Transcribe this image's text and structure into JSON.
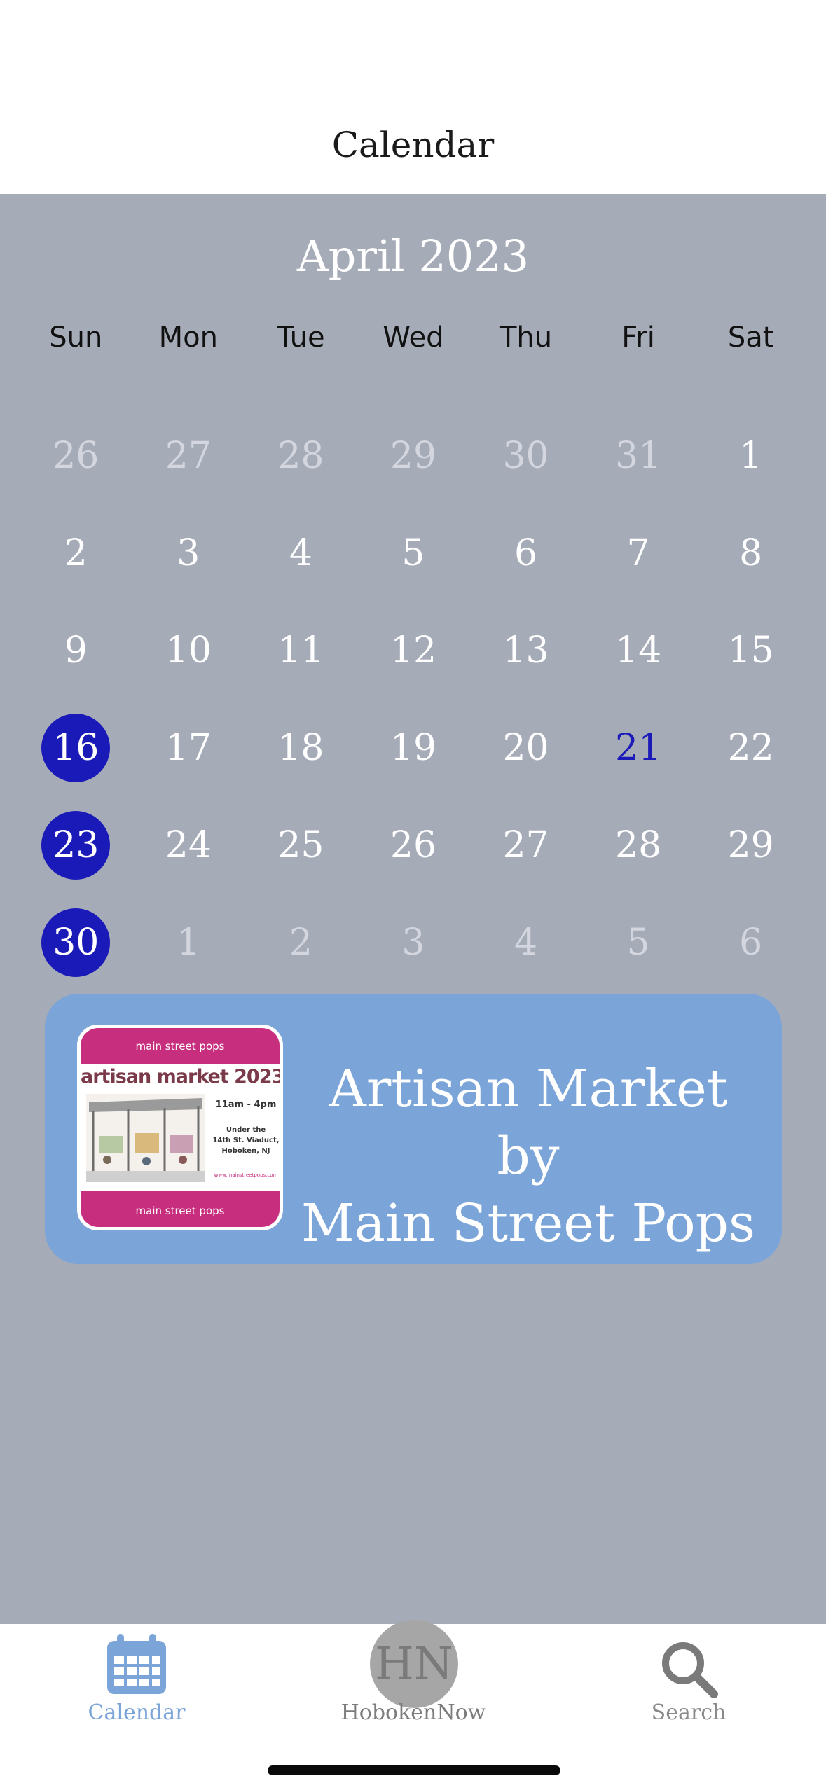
{
  "header": {
    "title": "Calendar"
  },
  "calendar": {
    "month_title": "April 2023",
    "weekdays": [
      "Sun",
      "Mon",
      "Tue",
      "Wed",
      "Thu",
      "Fri",
      "Sat"
    ],
    "days": [
      {
        "n": "26",
        "state": "muted"
      },
      {
        "n": "27",
        "state": "muted"
      },
      {
        "n": "28",
        "state": "muted"
      },
      {
        "n": "29",
        "state": "muted"
      },
      {
        "n": "30",
        "state": "muted"
      },
      {
        "n": "31",
        "state": "muted"
      },
      {
        "n": "1",
        "state": "normal"
      },
      {
        "n": "2",
        "state": "normal"
      },
      {
        "n": "3",
        "state": "normal"
      },
      {
        "n": "4",
        "state": "normal"
      },
      {
        "n": "5",
        "state": "normal"
      },
      {
        "n": "6",
        "state": "normal"
      },
      {
        "n": "7",
        "state": "normal"
      },
      {
        "n": "8",
        "state": "normal"
      },
      {
        "n": "9",
        "state": "normal"
      },
      {
        "n": "10",
        "state": "normal"
      },
      {
        "n": "11",
        "state": "normal"
      },
      {
        "n": "12",
        "state": "normal"
      },
      {
        "n": "13",
        "state": "normal"
      },
      {
        "n": "14",
        "state": "normal"
      },
      {
        "n": "15",
        "state": "normal"
      },
      {
        "n": "16",
        "state": "event"
      },
      {
        "n": "17",
        "state": "normal"
      },
      {
        "n": "18",
        "state": "normal"
      },
      {
        "n": "19",
        "state": "normal"
      },
      {
        "n": "20",
        "state": "normal"
      },
      {
        "n": "21",
        "state": "highlight"
      },
      {
        "n": "22",
        "state": "normal"
      },
      {
        "n": "23",
        "state": "event"
      },
      {
        "n": "24",
        "state": "normal"
      },
      {
        "n": "25",
        "state": "normal"
      },
      {
        "n": "26",
        "state": "normal"
      },
      {
        "n": "27",
        "state": "normal"
      },
      {
        "n": "28",
        "state": "normal"
      },
      {
        "n": "29",
        "state": "normal"
      },
      {
        "n": "30",
        "state": "event"
      },
      {
        "n": "1",
        "state": "muted"
      },
      {
        "n": "2",
        "state": "muted"
      },
      {
        "n": "3",
        "state": "muted"
      },
      {
        "n": "4",
        "state": "muted"
      },
      {
        "n": "5",
        "state": "muted"
      },
      {
        "n": "6",
        "state": "muted"
      }
    ]
  },
  "event": {
    "title_line1": "Artisan Market by",
    "title_line2": "Main Street Pops",
    "thumbnail": {
      "top_brand": "main street pops",
      "headline": "artisan market 2023",
      "time": "11am - 4pm",
      "location_line1": "Under the",
      "location_line2": "14th St. Viaduct,",
      "location_line3": "Hoboken, NJ",
      "url": "www.mainstreetpops.com",
      "bottom_brand": "main street pops"
    }
  },
  "tabbar": {
    "calendar_label": "Calendar",
    "home_label": "HobokenNow",
    "home_badge": "HN",
    "search_label": "Search"
  },
  "colors": {
    "background": "#a6abb8",
    "event_dot": "#1a1ab8",
    "card": "#7ba4d8",
    "accent_pink": "#c72f7e"
  },
  "icons": [
    "calendar-icon",
    "search-icon"
  ]
}
